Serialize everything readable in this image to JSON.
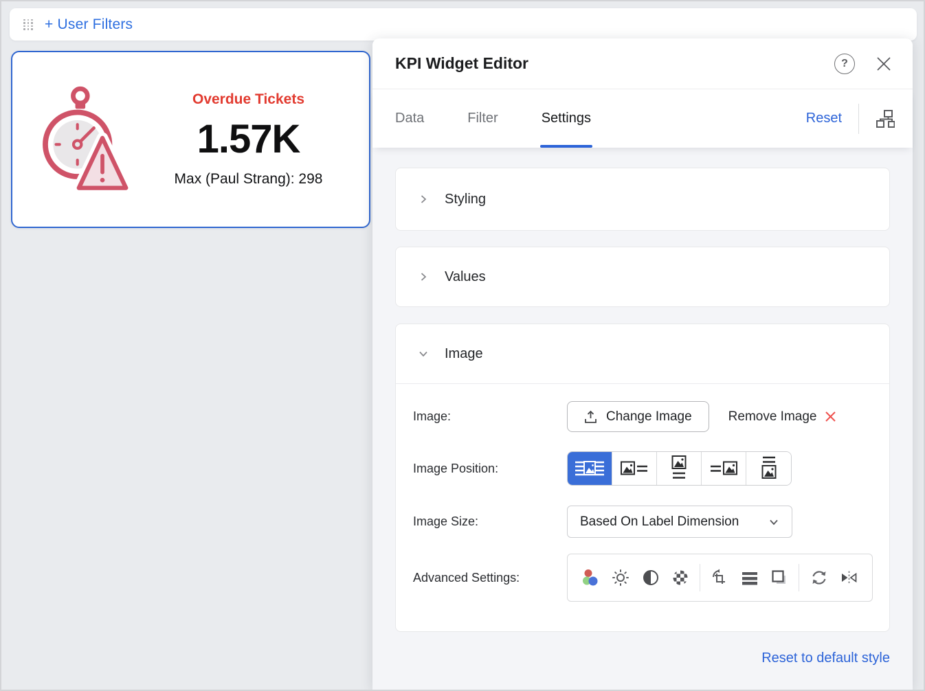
{
  "colors": {
    "link_blue": "#2c63d8",
    "user_filters_blue": "#2e6fe0",
    "selected_position_blue": "#3a6ed8",
    "kpi_title_red": "#e23b30",
    "remove_x_red": "#ef5350",
    "kpi_icon_rose": "#cf5368",
    "panel_background": "#f4f5f8",
    "canvas_background": "#e9ebee"
  },
  "canvas": {
    "user_filters": {
      "label": "+ User Filters",
      "drag_icon": "grid-dots-icon"
    }
  },
  "kpi_widget": {
    "icon": "stopwatch-alert-icon",
    "title": "Overdue Tickets",
    "value": "1.57K",
    "subtitle": "Max (Paul Strang): 298"
  },
  "editor": {
    "title": "KPI Widget Editor",
    "header_icons": {
      "help_glyph": "?",
      "close": "close-icon"
    },
    "tabs": [
      {
        "label": "Data",
        "active": false
      },
      {
        "label": "Filter",
        "active": false
      },
      {
        "label": "Settings",
        "active": true
      }
    ],
    "reset_label": "Reset",
    "layout_icon": "org-chart-icon",
    "sections": [
      {
        "label": "Styling",
        "expanded": false
      },
      {
        "label": "Values",
        "expanded": false
      },
      {
        "label": "Image",
        "expanded": true
      }
    ],
    "image_settings": {
      "image_label": "Image:",
      "change_image": "Change Image",
      "remove_image": "Remove Image",
      "position_label": "Image Position:",
      "position_options": [
        "image-background-position",
        "image-left-position",
        "image-top-position",
        "image-right-position",
        "image-bottom-position"
      ],
      "position_selected_index": 0,
      "size_label": "Image Size:",
      "size_value": "Based On Label Dimension",
      "advanced_label": "Advanced Settings:",
      "advanced_tools": [
        "color-saturation",
        "brightness",
        "contrast",
        "opacity",
        "crop-rotate",
        "line-thickness",
        "shadow",
        "reset-image",
        "flip-horizontal"
      ]
    },
    "footer_link": "Reset to default style"
  }
}
